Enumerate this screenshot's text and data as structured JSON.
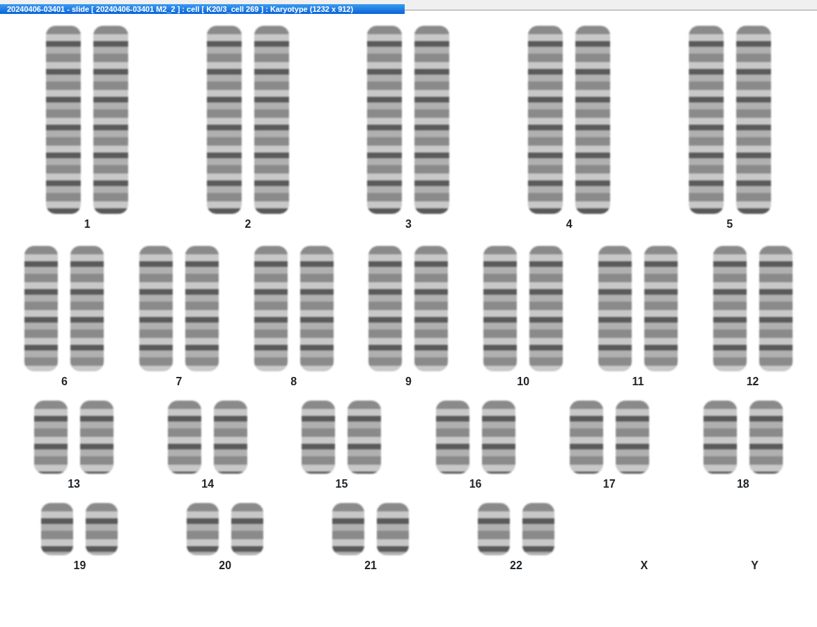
{
  "window": {
    "title": "20240406-03401 - slide [ 20240406-03401 M2_2 ] : cell [ K20/3_cell 269 ] : Karyotype  (1232 x 912)"
  },
  "karyotype_rows": [
    {
      "kind": "large",
      "groups": [
        {
          "label": "1",
          "kind": "pair"
        },
        {
          "label": "2",
          "kind": "pair"
        },
        {
          "label": "3",
          "kind": "pair"
        },
        {
          "label": "4",
          "kind": "pair"
        },
        {
          "label": "5",
          "kind": "pair"
        }
      ]
    },
    {
      "kind": "medium",
      "groups": [
        {
          "label": "6",
          "kind": "pair"
        },
        {
          "label": "7",
          "kind": "pair"
        },
        {
          "label": "8",
          "kind": "pair"
        },
        {
          "label": "9",
          "kind": "pair"
        },
        {
          "label": "10",
          "kind": "pair"
        },
        {
          "label": "11",
          "kind": "pair"
        },
        {
          "label": "12",
          "kind": "pair"
        }
      ]
    },
    {
      "kind": "small",
      "groups": [
        {
          "label": "13",
          "kind": "pair"
        },
        {
          "label": "14",
          "kind": "pair"
        },
        {
          "label": "15",
          "kind": "pair"
        },
        {
          "label": "16",
          "kind": "pair"
        },
        {
          "label": "17",
          "kind": "pair"
        },
        {
          "label": "18",
          "kind": "pair"
        }
      ]
    },
    {
      "kind": "tiny",
      "groups": [
        {
          "label": "19",
          "kind": "pair"
        },
        {
          "label": "20",
          "kind": "pair"
        },
        {
          "label": "21",
          "kind": "pair"
        },
        {
          "label": "22",
          "kind": "pair"
        },
        {
          "label": "X",
          "kind": "empty"
        },
        {
          "label": "Y",
          "kind": "empty"
        }
      ]
    }
  ]
}
